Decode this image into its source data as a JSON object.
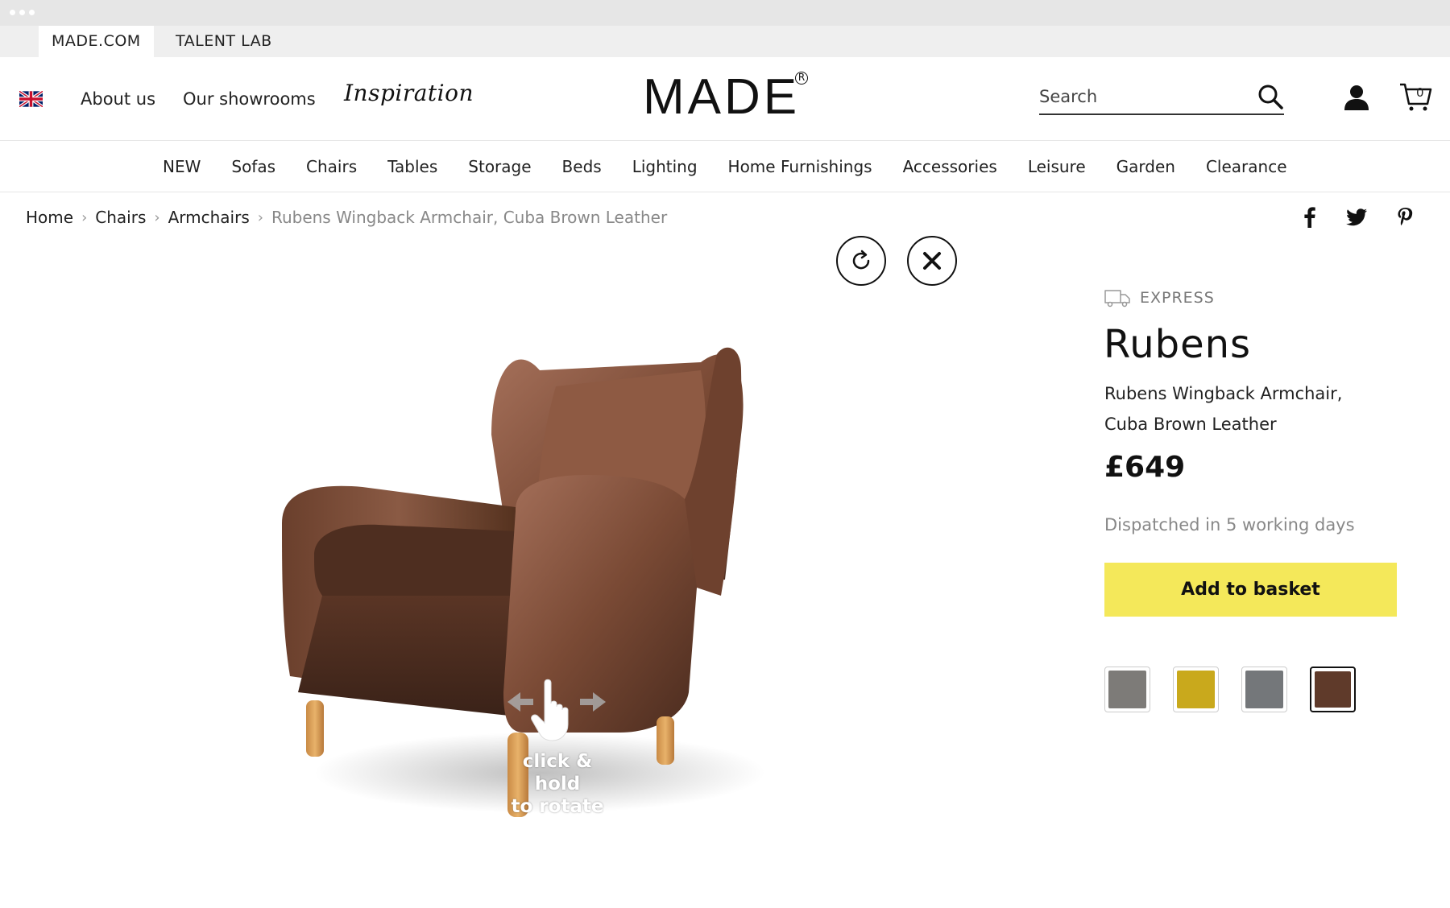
{
  "site_tabs": [
    "MADE.COM",
    "TALENT LAB"
  ],
  "header": {
    "links": [
      "About us",
      "Our showrooms"
    ],
    "inspiration": "Inspiration",
    "logo": "MADE",
    "logo_mark": "R",
    "search_placeholder": "Search",
    "cart_count": "0"
  },
  "categories": [
    "NEW",
    "Sofas",
    "Chairs",
    "Tables",
    "Storage",
    "Beds",
    "Lighting",
    "Home Furnishings",
    "Accessories",
    "Leisure",
    "Garden",
    "Clearance"
  ],
  "breadcrumb": {
    "items": [
      "Home",
      "Chairs",
      "Armchairs"
    ],
    "current": "Rubens Wingback Armchair, Cuba Brown Leather"
  },
  "viewer": {
    "hint_line1": "click & hold",
    "hint_line2": "to rotate"
  },
  "product": {
    "express_label": "EXPRESS",
    "name": "Rubens",
    "description_line1": "Rubens Wingback Armchair,",
    "description_line2": "Cuba Brown Leather",
    "price": "£649",
    "dispatch": "Dispatched in 5 working days",
    "add_to_basket": "Add to basket"
  },
  "swatches": [
    {
      "color": "#7d7b78",
      "selected": false
    },
    {
      "color": "#c9a91c",
      "selected": false
    },
    {
      "color": "#74777a",
      "selected": false
    },
    {
      "color": "#5f3a2a",
      "selected": true
    }
  ],
  "colors": {
    "accent_button": "#f4e85a",
    "leather": "#7a4a35"
  }
}
